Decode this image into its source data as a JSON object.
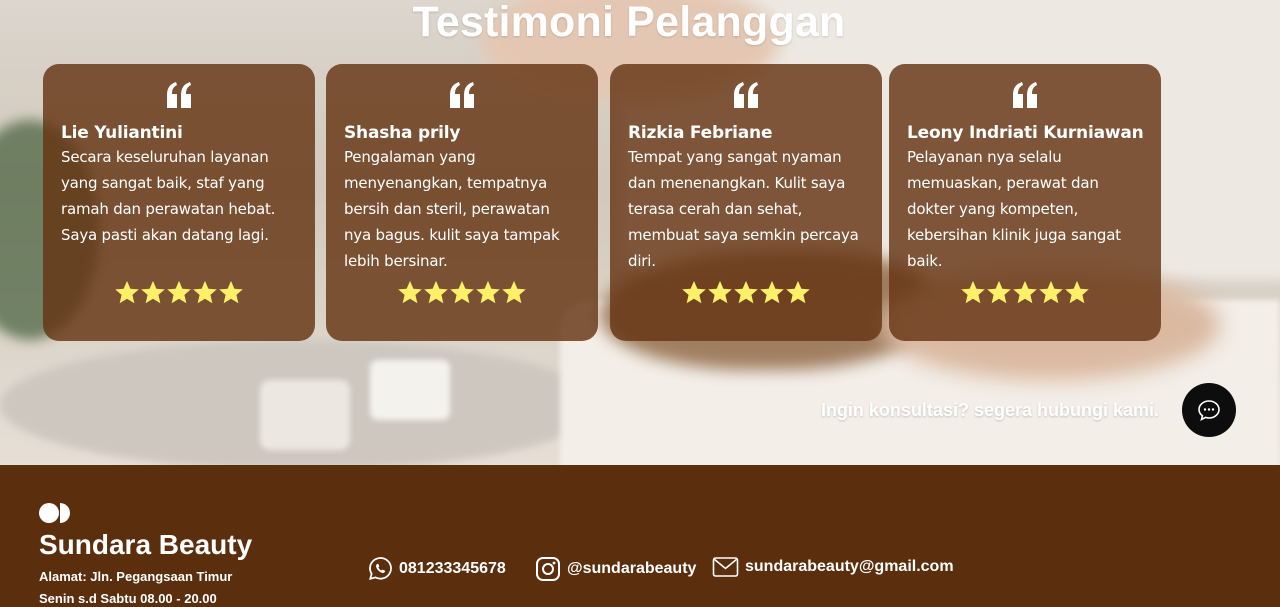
{
  "section": {
    "title": "Testimoni Pelanggan"
  },
  "testimonials": [
    {
      "name": "Lie Yuliantini",
      "text": "Secara keseluruhan layanan yang sangat baik, staf yang ramah dan perawatan hebat. Saya pasti akan datang lagi.",
      "rating": 5
    },
    {
      "name": "Shasha prily",
      "text": "Pengalaman yang menyenangkan, tempatnya bersih dan steril, perawatan nya bagus. kulit saya tampak lebih bersinar.",
      "rating": 5
    },
    {
      "name": "Rizkia Febriane",
      "text": "Tempat yang sangat nyaman dan menenangkan. Kulit saya terasa cerah dan sehat, membuat saya semkin percaya diri.",
      "rating": 5
    },
    {
      "name": "Leony Indriati Kurniawan",
      "text": "Pelayanan nya selalu memuaskan, perawat dan dokter yang kompeten, kebersihan klinik juga sangat baik.",
      "rating": 5
    }
  ],
  "cta": {
    "text": "Ingin konsultasi? segera hubungi kami.",
    "icon": "chat-bubble-icon"
  },
  "footer": {
    "brand": "Sundara Beauty",
    "address": "Alamat: Jln. Pegangsaan Timur",
    "hours": "Senin s.d Sabtu 08.00 - 20.00",
    "phone": "081233345678",
    "instagram": "@sundarabeauty",
    "email": "sundarabeauty@gmail.com"
  },
  "colors": {
    "card_bg": "#653414",
    "footer_bg": "#5b2e0e",
    "star": "#fff06a",
    "chat_button": "#0d0d0d"
  }
}
